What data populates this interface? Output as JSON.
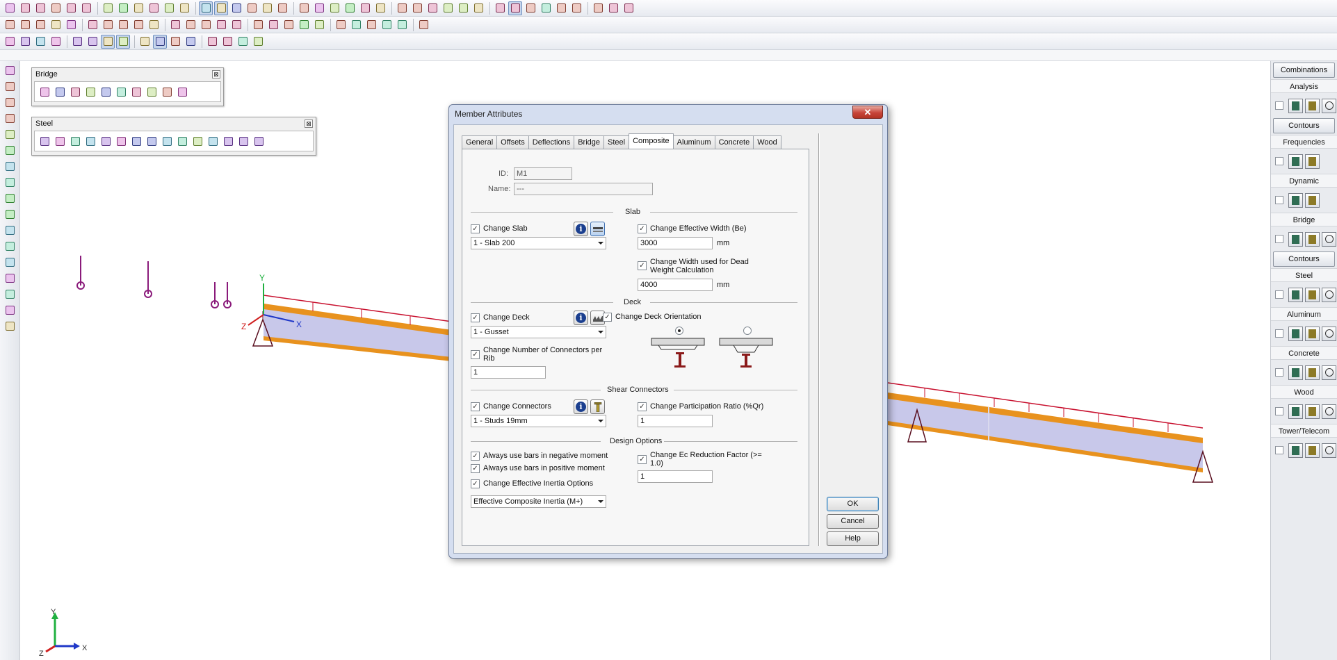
{
  "toolbars": {
    "row1_icons": [
      "new-icon",
      "open-icon",
      "save-icon",
      "print-icon",
      "undo-icon",
      "redo-icon",
      "connect-icon",
      "renumber-icon",
      "rotate-icon",
      "line-icon",
      "drawing-icon",
      "render-icon",
      "model-view-icon",
      "select-icon",
      "spreadsheet-icon",
      "joint-icon",
      "member-icon",
      "plate-icon",
      "solid-icon",
      "box-icon",
      "extrude-icon",
      "cylinder-icon",
      "wire-icon",
      "sphere-icon",
      "label-icon",
      "query-icon",
      "load-icon",
      "support-icon",
      "release-icon",
      "offset-icon",
      "grid-icon",
      "snap-icon",
      "arrow-icon",
      "dimension-icon",
      "split-icon",
      "merge-icon",
      "rigid-icon",
      "link-icon",
      "draw-icon"
    ],
    "row2_icons": [
      "table-icon",
      "check-icon",
      "solve-icon",
      "filter-icon",
      "cut-icon",
      "copy-icon",
      "paste-icon",
      "clear-icon",
      "scale-icon",
      "mirror-icon",
      "move-icon",
      "array-icon",
      "frame-icon",
      "wall-icon",
      "roof-icon",
      "level-icon",
      "node-icon",
      "angle-icon",
      "triangle-icon",
      "palette-icon",
      "brush-icon",
      "grid-edit-icon",
      "layer-icon",
      "attribute-icon",
      "move-copy-icon",
      "graph-icon"
    ],
    "row3_icons": [
      "window-select-icon",
      "frame-select-icon",
      "box-select-icon",
      "filter-select-icon",
      "layer-select-icon",
      "group-select-icon",
      "cursor-icon",
      "pointer-icon",
      "rubber-icon",
      "rect-select-icon",
      "lasso-icon",
      "poly-select-icon",
      "hide-icon",
      "show-icon",
      "highlight-icon",
      "inverse-icon"
    ],
    "left_icons": [
      "pan-icon",
      "globe-icon",
      "nodes-icon",
      "orbit-icon",
      "zoom-in-icon",
      "zoom-out-icon",
      "cube-front-icon",
      "cube-side-icon",
      "cube-top-icon",
      "cube-iso-icon",
      "cube-shade-icon",
      "cube-wire-icon",
      "cube-solid-icon",
      "fit-icon",
      "transport-icon",
      "eye-icon",
      "layers-icon"
    ]
  },
  "palettes": {
    "bridge": {
      "title": "Bridge",
      "close": "⊠",
      "icons": [
        "bridge-member-icon",
        "bridge-load-icon",
        "lane-icon",
        "vehicle-icon",
        "moving-load-icon",
        "influence-icon",
        "deck-icon",
        "bearing-icon",
        "stage-icon",
        "bridge-report-icon"
      ]
    },
    "steel": {
      "title": "Steel",
      "close": "⊠",
      "icons": [
        "steel-member-icon",
        "steel-section-icon",
        "steel-red-icon",
        "steel-beam-icon",
        "steel-girder-icon",
        "steel-formula-icon",
        "steel-graph-icon",
        "steel-plate-icon",
        "steel-bolt-icon",
        "steel-tee-icon",
        "steel-i-icon",
        "steel-down-icon",
        "steel-rotate-icon",
        "steel-hammer-icon",
        "steel-column-icon"
      ]
    }
  },
  "right_panel": {
    "sections": [
      {
        "type": "button",
        "label": "Combinations"
      },
      {
        "type": "label",
        "label": "Analysis"
      },
      {
        "type": "row"
      },
      {
        "type": "button",
        "label": "Contours"
      },
      {
        "type": "label",
        "label": "Frequencies"
      },
      {
        "type": "row"
      },
      {
        "type": "label",
        "label": "Dynamic"
      },
      {
        "type": "row"
      },
      {
        "type": "label",
        "label": "Bridge"
      },
      {
        "type": "row"
      },
      {
        "type": "button",
        "label": "Contours"
      },
      {
        "type": "label",
        "label": "Steel"
      },
      {
        "type": "row"
      },
      {
        "type": "label",
        "label": "Aluminum"
      },
      {
        "type": "row"
      },
      {
        "type": "label",
        "label": "Concrete"
      },
      {
        "type": "row"
      },
      {
        "type": "label",
        "label": "Wood"
      },
      {
        "type": "row"
      },
      {
        "type": "label",
        "label": "Tower/Telecom"
      },
      {
        "type": "row"
      }
    ]
  },
  "viewport": {
    "axis_labels": {
      "x": "X",
      "y": "Y",
      "z": "Z"
    },
    "colors": {
      "beam_flange": "#e8921e",
      "beam_web": "#c8c8ea",
      "rail": "#c8102e",
      "support": "#5a1020",
      "load_marker": "#8a1a7a",
      "axis_x": "#2038c8",
      "axis_y": "#20b040",
      "axis_z": "#d02020"
    }
  },
  "dialog": {
    "title": "Member Attributes",
    "close": "✕",
    "tabs": [
      "General",
      "Offsets",
      "Deflections",
      "Bridge",
      "Steel",
      "Composite",
      "Aluminum",
      "Concrete",
      "Wood"
    ],
    "active_tab": "Composite",
    "id_label": "ID:",
    "id_value": "M1",
    "name_label": "Name:",
    "name_value": "---",
    "slab": {
      "title": "Slab",
      "change_slab": {
        "label": "Change Slab",
        "checked": "✓"
      },
      "slab_value": "1 - Slab 200",
      "change_eff_width": {
        "label": "Change Effective Width (Be)",
        "checked": "✓"
      },
      "eff_width_value": "3000",
      "eff_width_unit": "mm",
      "change_dead_width": {
        "label_line1": "Change Width used for Dead",
        "label_line2": "Weight Calculation",
        "checked": "✓"
      },
      "dead_width_value": "4000",
      "dead_width_unit": "mm"
    },
    "deck": {
      "title": "Deck",
      "change_deck": {
        "label": "Change Deck",
        "checked": "✓"
      },
      "deck_value": "1 - Gusset",
      "change_orientation": {
        "label": "Change Deck Orientation",
        "checked": "✓"
      },
      "change_connectors_rib": {
        "label_line1": "Change Number of Connectors per",
        "label_line2": "Rib",
        "checked": "✓"
      },
      "connectors_rib_value": "1"
    },
    "shear": {
      "title": "Shear Connectors",
      "change_connectors": {
        "label": "Change Connectors",
        "checked": "✓"
      },
      "connectors_value": "1 - Studs 19mm",
      "change_participation": {
        "label": "Change Participation Ratio (%Qr)",
        "checked": "✓"
      },
      "participation_value": "1"
    },
    "design": {
      "title": "Design Options",
      "neg_moment": {
        "label": "Always use bars in negative moment",
        "checked": "✓"
      },
      "pos_moment": {
        "label": "Always use bars in positive moment",
        "checked": "✓"
      },
      "eff_inertia": {
        "label": "Change Effective Inertia Options",
        "checked": "✓"
      },
      "inertia_value": "Effective Composite Inertia (M+)",
      "change_ec": {
        "label_line1": "Change Ec Reduction Factor (>=",
        "label_line2": "1.0)",
        "checked": "✓"
      },
      "ec_value": "1"
    },
    "buttons": {
      "ok": "OK",
      "cancel": "Cancel",
      "help": "Help"
    },
    "info_glyph": "i"
  }
}
